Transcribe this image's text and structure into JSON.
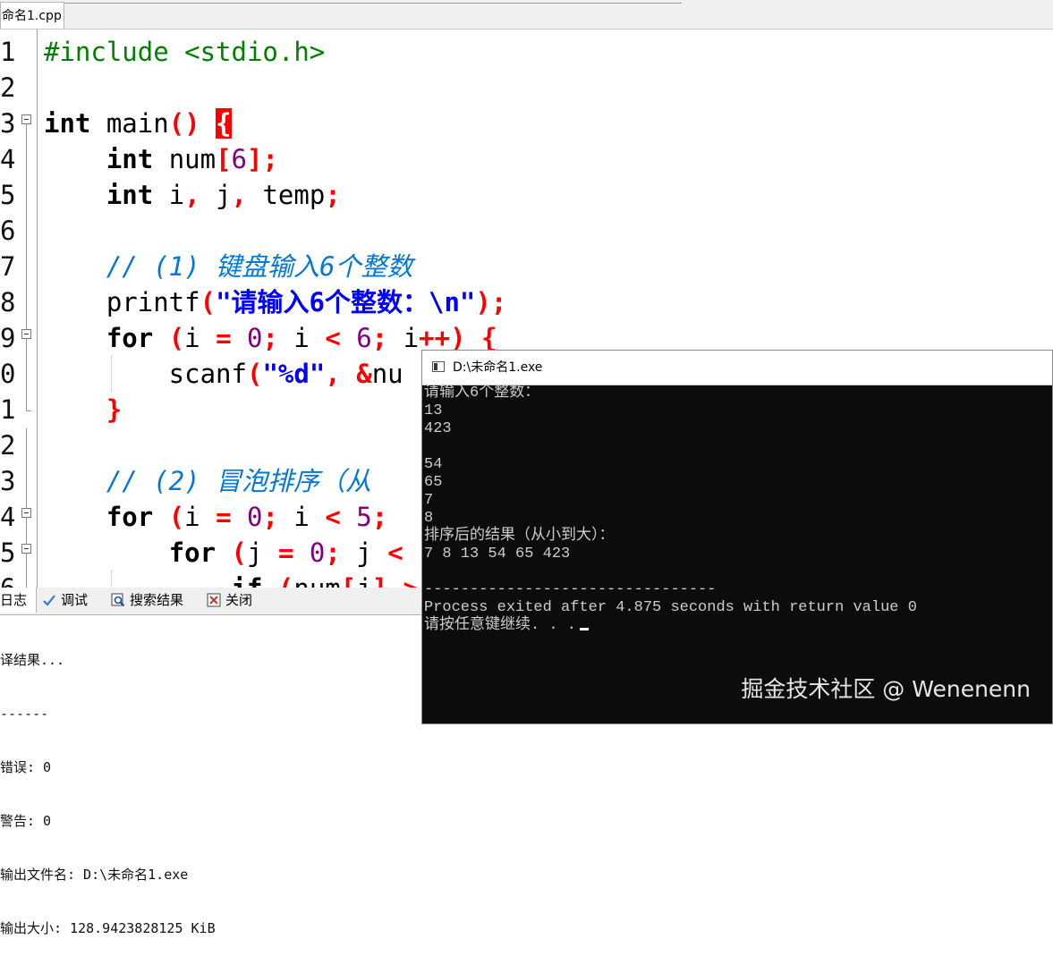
{
  "editor_tab": {
    "label": "命名1.cpp"
  },
  "editor": {
    "line_numbers": [
      "1",
      "2",
      "3",
      "4",
      "5",
      "6",
      "7",
      "8",
      "9",
      "0",
      "1",
      "2",
      "3",
      "4",
      "5",
      "6"
    ],
    "lines": [
      "#include <stdio.h>",
      "",
      "int main() {",
      "    int num[6];",
      "    int i, j, temp;",
      "",
      "    // (1) 键盘输入6个整数",
      "    printf(\"请输入6个整数：\\n\");",
      "    for (i = 0; i < 6; i++) {",
      "        scanf(\"%d\", &nu",
      "    }",
      "",
      "    // (2) 冒泡排序（从",
      "    for (i = 0; i < 5;",
      "        for (j = 0; j <",
      "            if (num[j] >"
    ]
  },
  "bottom_panel": {
    "tabs": [
      {
        "label": "日志",
        "icon": "log-icon"
      },
      {
        "label": "调试",
        "icon": "debug-icon"
      },
      {
        "label": "搜索结果",
        "icon": "search-icon"
      },
      {
        "label": "关闭",
        "icon": "close-icon"
      }
    ],
    "log_lines": [
      "译结果...",
      "------",
      "错误: 0",
      "警告: 0",
      "输出文件名: D:\\未命名1.exe",
      "输出大小: 128.9423828125 KiB"
    ]
  },
  "console": {
    "title": "D:\\未命名1.exe",
    "lines": [
      "请输入6个整数：",
      "13",
      "423",
      "",
      "54",
      "65",
      "7",
      "8",
      "排序后的结果（从小到大）：",
      "7 8 13 54 65 423",
      "",
      "--------------------------------",
      "Process exited after 4.875 seconds with return value 0",
      "请按任意键继续. . ."
    ],
    "watermark": "掘金技术社区 @ Wenenenn"
  }
}
